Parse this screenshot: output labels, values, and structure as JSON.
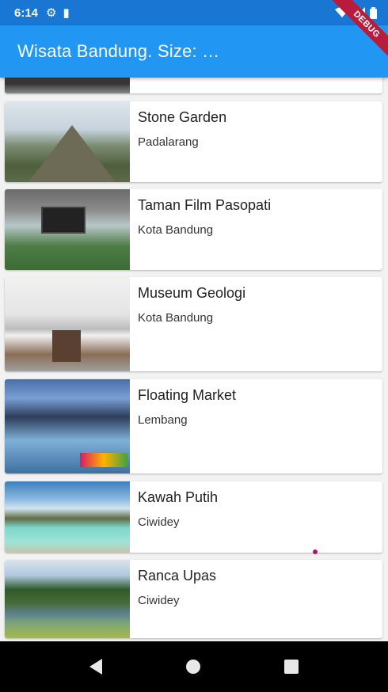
{
  "status_bar": {
    "time": "6:14",
    "settings_icon": "gear-icon",
    "sim_icon": "sd-card-icon",
    "wifi_icon": "wifi-icon",
    "signal_icon": "signal-icon",
    "battery_icon": "battery-icon"
  },
  "app_bar": {
    "title": "Wisata Bandung. Size: …",
    "debug_banner": "DEBUG"
  },
  "places": [
    {
      "name": "Stone Garden",
      "location": "Padalarang"
    },
    {
      "name": "Taman Film Pasopati",
      "location": "Kota Bandung"
    },
    {
      "name": "Museum Geologi",
      "location": "Kota Bandung"
    },
    {
      "name": "Floating Market",
      "location": "Lembang"
    },
    {
      "name": "Kawah Putih",
      "location": "Ciwidey"
    },
    {
      "name": "Ranca Upas",
      "location": "Ciwidey"
    }
  ],
  "colors": {
    "status_bar": "#1976d2",
    "app_bar": "#2196f3",
    "debug_banner": "#b71c3c"
  }
}
